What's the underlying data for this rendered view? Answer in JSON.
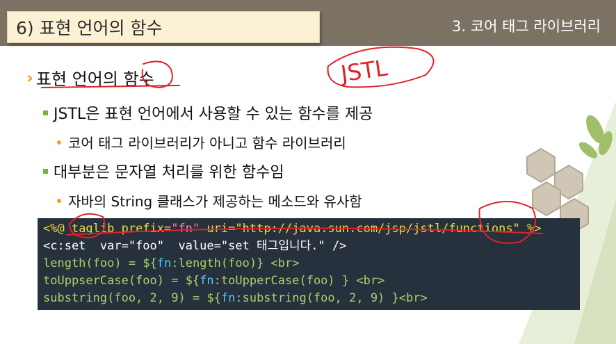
{
  "header": {
    "title": "6) 표현 언어의 함수",
    "section": "3. 코어 태그 라이브러리"
  },
  "heading": {
    "chevron": "›",
    "text": "표현 언어의 함수"
  },
  "bullets": [
    {
      "text": "JSTL은 표현 언어에서 사용할 수 있는 함수를 제공"
    },
    {
      "text": "코어 태그 라이브러리가 아니고 함수 라이브러리"
    },
    {
      "text": "대부분은 문자열 처리를 위한 함수임"
    },
    {
      "text": "자바의 String 클래스가 제공하는 메소드와 유사함"
    }
  ],
  "code": {
    "line1": {
      "open": "<%@ ",
      "kw": "taglib prefix=",
      "pv": "\"fn\"",
      "uri_kw": " uri=",
      "uri_val": "\"http://java.sun.com/jsp/jstl/functions\"",
      "close": " %>"
    },
    "line2": "<c:set  var=\"foo\"  value=\"set 태그입니다.\" />",
    "line3": {
      "a": "length(foo) = ${",
      "fn": "fn",
      "b": ":length(foo)} <br>"
    },
    "line4": {
      "a": "toUppserCase(foo) = ${",
      "fn": "fn",
      "b": ":toUpperCase(foo) } <br>"
    },
    "line5": {
      "a": "substring(foo, 2, 9) = ${",
      "fn": "fn",
      "b": ":substring(foo, 2, 9) }<br>"
    }
  },
  "annotation": {
    "handwritten": "JSTL"
  },
  "colors": {
    "band": "#7b7263",
    "title_bg": "#fbf1d4",
    "chevron": "#f0a21a",
    "square_bullet": "#7bb23a",
    "code_bg": "#27313d",
    "ink": "#e0222a"
  }
}
